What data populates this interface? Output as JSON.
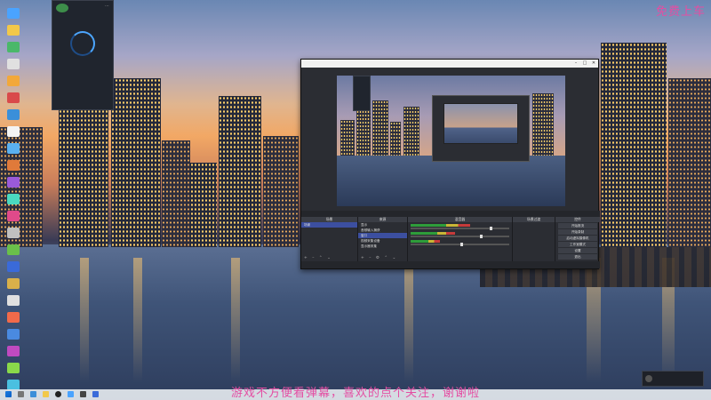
{
  "overlay": {
    "corner_text": "免费上车",
    "subtitle": "游戏不方便看弹幕，喜欢的点个关注，谢谢啦"
  },
  "colors": {
    "overlay_text": "#e44ea3",
    "obs_selected": "#3c4fa0"
  },
  "desktop_icons": [
    {
      "name": "app-icon",
      "color": "#4aa3ff"
    },
    {
      "name": "app-icon",
      "color": "#f2c84a"
    },
    {
      "name": "app-icon",
      "color": "#4ab86a"
    },
    {
      "name": "app-icon",
      "color": "#e0e0e0"
    },
    {
      "name": "app-icon",
      "color": "#f2a83a"
    },
    {
      "name": "app-icon",
      "color": "#d94a4a"
    },
    {
      "name": "app-icon",
      "color": "#3a8fd9"
    },
    {
      "name": "app-icon",
      "color": "#f4f4f4"
    },
    {
      "name": "app-icon",
      "color": "#5ab0f0"
    },
    {
      "name": "app-icon",
      "color": "#e07a3a"
    },
    {
      "name": "app-icon",
      "color": "#9a5ad9"
    },
    {
      "name": "app-icon",
      "color": "#4ad9c0"
    },
    {
      "name": "app-icon",
      "color": "#e04a8a"
    },
    {
      "name": "app-icon",
      "color": "#c0c0c0"
    },
    {
      "name": "app-icon",
      "color": "#6ac04a"
    },
    {
      "name": "app-icon",
      "color": "#3a6ad9"
    },
    {
      "name": "app-icon",
      "color": "#d9b04a"
    },
    {
      "name": "app-icon",
      "color": "#e0e0e0"
    },
    {
      "name": "app-icon",
      "color": "#f26a4a"
    },
    {
      "name": "app-icon",
      "color": "#4a8ae0"
    },
    {
      "name": "app-icon",
      "color": "#c04ac0"
    },
    {
      "name": "app-icon",
      "color": "#8ad94a"
    },
    {
      "name": "app-icon",
      "color": "#4ac0e0"
    }
  ],
  "obs": {
    "window_buttons": [
      "–",
      "□",
      "✕"
    ],
    "tabs_bar": [
      "场景",
      "来源",
      "混音器",
      "场景过渡",
      "控件"
    ],
    "scenes": {
      "header": "场景",
      "items": [
        "场景"
      ],
      "footer": "+ – ⌃ ⌄"
    },
    "sources": {
      "header": "来源",
      "items": [
        "显示",
        "音频输入捕获",
        "窗口",
        "视频采集设备",
        "显示器采集"
      ],
      "footer": "+ – ⚙ ⌃ ⌄"
    },
    "mixer": {
      "header": "混音器",
      "tracks": [
        {
          "level": 0.6,
          "fader": 0.8
        },
        {
          "level": 0.45,
          "fader": 0.7
        },
        {
          "level": 0.3,
          "fader": 0.5
        }
      ]
    },
    "transitions": {
      "header": "场景过渡"
    },
    "controls": {
      "header": "控件",
      "buttons": [
        "开始推流",
        "开始录制",
        "启动虚拟摄像机",
        "工作室模式",
        "设置",
        "退出"
      ]
    }
  }
}
